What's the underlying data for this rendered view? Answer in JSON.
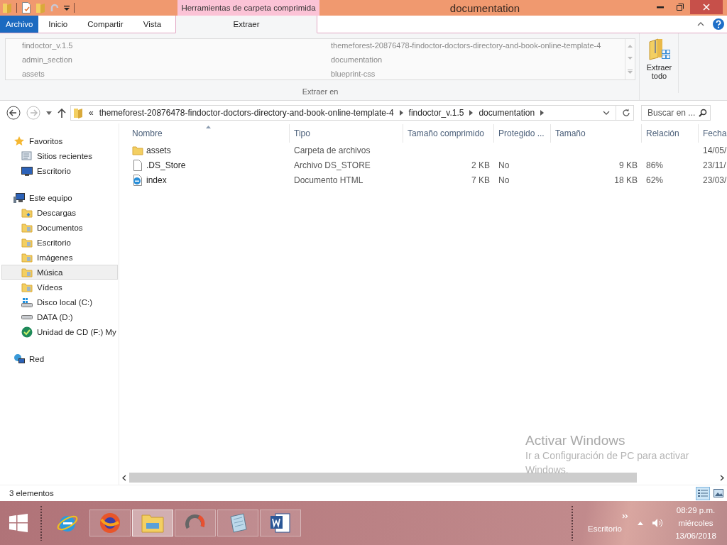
{
  "window": {
    "title": "documentation",
    "context_tab_group": "Herramientas de carpeta comprimida"
  },
  "ribbon": {
    "tabs": [
      {
        "label": "Archivo",
        "kind": "file",
        "selected": false
      },
      {
        "label": "Inicio",
        "kind": "tab",
        "selected": false
      },
      {
        "label": "Compartir",
        "kind": "tab",
        "selected": false
      },
      {
        "label": "Vista",
        "kind": "tab",
        "selected": false
      },
      {
        "label": "Extraer",
        "kind": "context",
        "selected": true
      }
    ],
    "extract_locations": [
      "findoctor_v.1.5",
      "themeforest-20876478-findoctor-doctors-directory-and-book-online-template-4",
      "admin_section",
      "documentation",
      "assets",
      "blueprint-css"
    ],
    "group_label": "Extraer en",
    "extract_all_button": "Extraer todo"
  },
  "address_bar": {
    "overflow": "«",
    "breadcrumbs": [
      "themeforest-20876478-findoctor-doctors-directory-and-book-online-template-4",
      "findoctor_v.1.5",
      "documentation"
    ]
  },
  "search": {
    "placeholder": "Buscar en ..."
  },
  "sidebar": {
    "groups": [
      {
        "label": "Favoritos",
        "children": [
          {
            "label": "Sitios recientes",
            "selected": false
          },
          {
            "label": "Escritorio",
            "selected": false
          }
        ]
      },
      {
        "label": "Este equipo",
        "children": [
          {
            "label": "Descargas",
            "selected": false
          },
          {
            "label": "Documentos",
            "selected": false
          },
          {
            "label": "Escritorio",
            "selected": false
          },
          {
            "label": "Imágenes",
            "selected": false
          },
          {
            "label": "Música",
            "selected": true
          },
          {
            "label": "Vídeos",
            "selected": false
          },
          {
            "label": "Disco local (C:)",
            "selected": false
          },
          {
            "label": "DATA (D:)",
            "selected": false
          },
          {
            "label": "Unidad de CD (F:) My",
            "selected": false
          }
        ]
      },
      {
        "label": "Red"
      }
    ]
  },
  "table": {
    "columns": [
      "Nombre",
      "Tipo",
      "Tamaño comprimido",
      "Protegido ...",
      "Tamaño",
      "Relación",
      "Fecha"
    ],
    "rows": [
      {
        "kind": "folder",
        "name": "assets",
        "type": "Carpeta de archivos",
        "compressed": "",
        "protected": "",
        "size": "",
        "ratio": "",
        "date": "14/05/"
      },
      {
        "kind": "file",
        "name": ".DS_Store",
        "type": "Archivo DS_STORE",
        "compressed": "2 KB",
        "protected": "No",
        "size": "9 KB",
        "ratio": "86%",
        "date": "23/11/"
      },
      {
        "kind": "html",
        "name": "index",
        "type": "Documento HTML",
        "compressed": "7 KB",
        "protected": "No",
        "size": "18 KB",
        "ratio": "62%",
        "date": "23/03/"
      }
    ]
  },
  "activation_notice": {
    "title": "Activar Windows",
    "text": "Ir a Configuración de PC para activar Windows."
  },
  "status_bar": {
    "count": "3 elementos",
    "views": [
      {
        "kind": "details",
        "selected": true
      },
      {
        "kind": "large-icons",
        "selected": false
      }
    ]
  },
  "taskbar": {
    "apps": [
      {
        "kind": "ie",
        "selected": false
      },
      {
        "kind": "firefox",
        "selected": false
      },
      {
        "kind": "explorer",
        "selected": true
      },
      {
        "kind": "sync",
        "selected": false
      },
      {
        "kind": "notepad",
        "selected": false
      },
      {
        "kind": "word",
        "selected": false
      }
    ],
    "toolbar_label": "Escritorio",
    "time": "08:29 p.m.",
    "day": "miércoles",
    "date": "13/06/2018"
  }
}
